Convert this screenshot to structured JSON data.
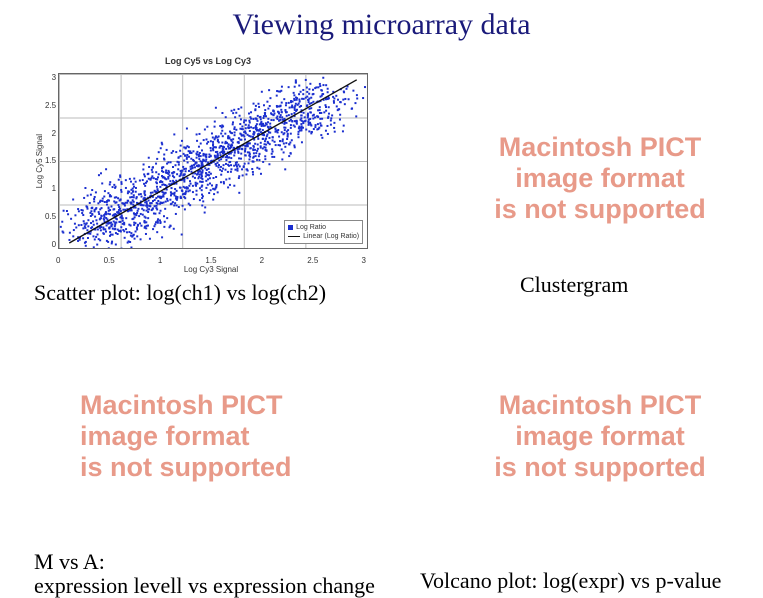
{
  "slide": {
    "title": "Viewing microarray data"
  },
  "captions": {
    "scatter": "Scatter plot: log(ch1) vs log(ch2)",
    "cluster": "Clustergram",
    "mva_line1": "M vs A:",
    "mva_line2": "expression levell vs expression change",
    "volcano": "Volcano plot: log(expr) vs p-value"
  },
  "pict_error": {
    "line1": "Macintosh PICT",
    "line2": "image format",
    "line3": "is not supported"
  },
  "chart_data": {
    "type": "scatter",
    "title": "Log Cy5 vs Log Cy3",
    "xlabel": "Log Cy3 Signal",
    "ylabel": "Log Cy5 Signal",
    "xlim": [
      0,
      3
    ],
    "ylim": [
      0,
      3
    ],
    "xticks": [
      0,
      0.5,
      1,
      1.5,
      2,
      2.5,
      3
    ],
    "yticks": [
      0,
      0.5,
      1,
      1.5,
      2,
      2.5,
      3
    ],
    "series": [
      {
        "name": "Log Ratio",
        "style": "points",
        "color": "#1a2ecf",
        "note": "dense diagonal point cloud, ~1800 points visually, centered on y=x from (0.4,0.4) to (2.6,2.6), spread ±0.5"
      },
      {
        "name": "Linear (Log Ratio)",
        "style": "line",
        "color": "#111",
        "x": [
          0.1,
          2.9
        ],
        "y": [
          0.1,
          2.9
        ]
      }
    ],
    "legend": {
      "position": "bottom-right",
      "entries": [
        "Log Ratio",
        "Linear (Log Ratio)"
      ]
    }
  }
}
